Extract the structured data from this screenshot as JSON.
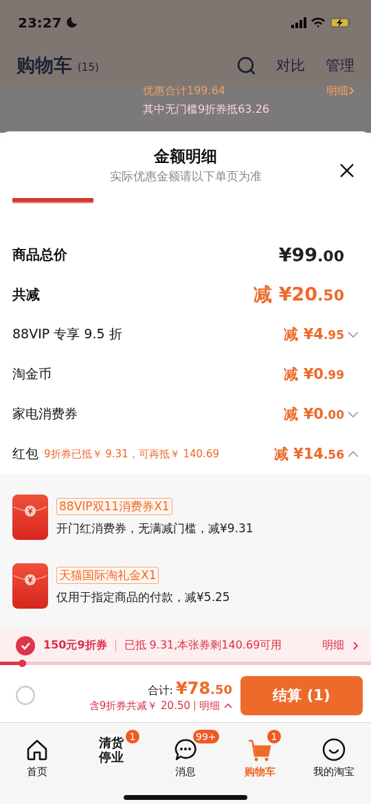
{
  "status_bar": {
    "time": "23:27"
  },
  "header": {
    "title": "购物车",
    "count": "(15)",
    "actions": [
      "对比",
      "管理"
    ]
  },
  "background_summary": {
    "discount_total": "优惠合计199.64",
    "detail_link": "明细",
    "coupon_note": "其中无门槛9折券抵63.26"
  },
  "sheet": {
    "title": "金额明细",
    "subtitle": "实际优惠金额请以下单页为准"
  },
  "rows": [
    {
      "kind": "total",
      "label": "商品总价",
      "amount": "¥99.00"
    },
    {
      "kind": "saving",
      "label": "共减",
      "amount": "减 ¥20.50"
    },
    {
      "kind": "toggle",
      "label": "88VIP 专享 9.5 折",
      "amount": "减 ¥4.95",
      "expanded": false
    },
    {
      "kind": "plain",
      "label": "淘金币",
      "amount": "减 ¥0.99"
    },
    {
      "kind": "toggle",
      "label": "家电消费券",
      "amount": "减 ¥0.00",
      "expanded": false
    },
    {
      "kind": "toggle",
      "label": "红包",
      "note": "9折券已抵￥ 9.31，可再抵￥ 140.69",
      "amount": "减 ¥14.56",
      "expanded": true
    }
  ],
  "coupons": [
    {
      "tag": "88VIP双11消费券X1",
      "description": "开门红消费券，无满减门槛，减¥9.31"
    },
    {
      "tag": "天猫国际淘礼金X1",
      "description": "仅用于指定商品的付款，减¥5.25"
    }
  ],
  "coupon_bar": {
    "checked": true,
    "title": "150元9折券",
    "status": "已抵 9.31,本张券剩140.69可用",
    "link": "明细",
    "level": 0.07
  },
  "checkout": {
    "checked": false,
    "total_label": "合计:",
    "total": "¥78.50",
    "savings": "含9折券共减￥ 20.50",
    "link": "明细",
    "button": "结算 (1)"
  },
  "tabs": [
    {
      "kind": "home",
      "label": "首页",
      "selected": false
    },
    {
      "kind": "promo",
      "label": "清货停业",
      "badge": "1",
      "selected": false
    },
    {
      "kind": "messages",
      "label": "消息",
      "badge": "99+",
      "selected": false
    },
    {
      "kind": "cart",
      "label": "购物车",
      "badge": "1",
      "selected": true
    },
    {
      "kind": "profile",
      "label": "我的淘宝",
      "selected": false
    }
  ]
}
